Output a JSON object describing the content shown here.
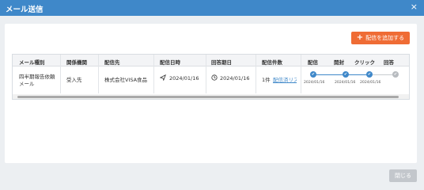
{
  "modal": {
    "title": "メール送信",
    "close_glyph": "×"
  },
  "toolbar": {
    "add_button_label": "配信を追加する",
    "add_icon": "plus-icon"
  },
  "table": {
    "headers": [
      "メール種別",
      "関係機関",
      "配信先",
      "配信日時",
      "回答期日",
      "配信件数",
      "配信",
      "開封",
      "クリック",
      "回答"
    ],
    "rows": [
      {
        "mail_type": "四半期報告依頼メール",
        "agency": "受入先",
        "recipient": "株式会社VISA食品",
        "sent_icon": "paper-plane-icon",
        "sent_at": "2024/01/16",
        "due_icon": "clock-icon",
        "due_date": "2024/01/16",
        "count": "1件",
        "detail_link": "配信済リスト",
        "status": {
          "sent_date": "2024/01/16",
          "open_date": "2024/01/16",
          "click_date": "2024/01/16",
          "check_glyph": "✔",
          "answered": false
        }
      }
    ]
  },
  "footer": {
    "close_button_label": "閉じる"
  }
}
